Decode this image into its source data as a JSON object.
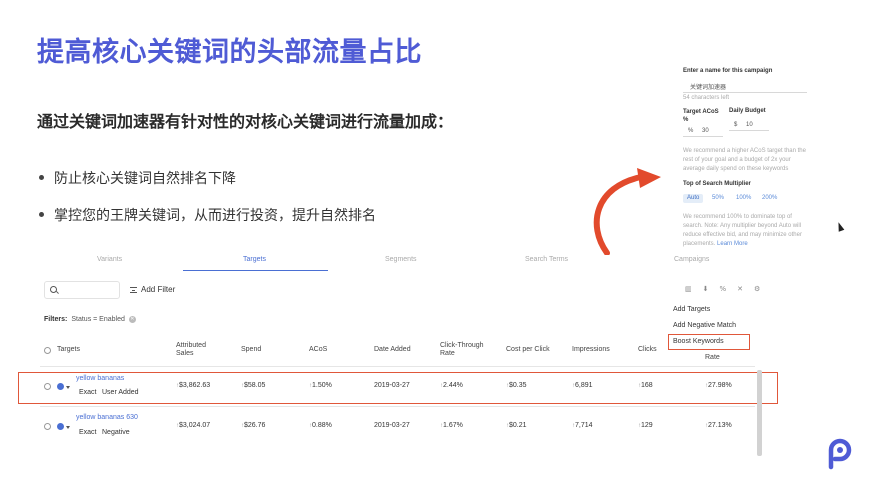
{
  "slide": {
    "title": "提高核心关键词的头部流量占比",
    "subtitle": "通过关键词加速器有针对性的对核心关键词进行流量加成：",
    "bullets": [
      "防止核心关键词自然排名下降",
      "掌控您的王牌关键词，从而进行投资，提升自然排名"
    ]
  },
  "panel": {
    "name_label": "Enter a name for this campaign",
    "name_value": "关键词加速器",
    "name_hint": "54 characters left",
    "target_acos_label": "Target ACoS %",
    "target_acos_prefix": "%",
    "target_acos_value": "30",
    "daily_budget_label": "Daily Budget",
    "daily_budget_prefix": "$",
    "daily_budget_value": "10",
    "note1": "We recommend a higher ACoS target than the rest of your goal and a budget of 2x your average daily spend on these keywords",
    "tos_label": "Top of Search Multiplier",
    "tos_options": [
      "Auto",
      "50%",
      "100%",
      "200%"
    ],
    "note2": "We recommend 100% to dominate top of search. Note: Any multiplier beyond Auto will reduce effective bid, and may minimize other placements.",
    "learn_more": "Learn More"
  },
  "tabs": [
    "Variants",
    "Targets",
    "Segments",
    "Search Terms",
    "Campaigns"
  ],
  "toolbar": {
    "search_placeholder": "",
    "add_filter": "Add Filter",
    "icons": [
      "columns-icon",
      "download-icon",
      "percent-icon",
      "close-icon",
      "settings-icon"
    ],
    "icon_glyphs": [
      "▥",
      "⬇",
      "%",
      "✕",
      "⚙"
    ]
  },
  "filters": {
    "label": "Filters:",
    "chip": "Status = Enabled"
  },
  "menu": {
    "items": [
      "Add Targets",
      "Add Negative Match",
      "Boost Keywords"
    ]
  },
  "table": {
    "headers": {
      "targets": "Targets",
      "attributed_sales": "Attributed Sales",
      "spend": "Spend",
      "acos": "ACoS",
      "date_added": "Date Added",
      "ctr": "Click-Through Rate",
      "cpc": "Cost per Click",
      "impressions": "Impressions",
      "clicks": "Clicks",
      "conv_rate_partial": "Rate"
    },
    "rows": [
      {
        "keyword": "yellow bananas",
        "match": "Exact",
        "tag": "User Added",
        "sales": "$3,862.63",
        "spend": "$58.05",
        "acos": "1.50%",
        "date": "2019-03-27",
        "ctr": "2.44%",
        "cpc": "$0.35",
        "impressions": "6,891",
        "clicks": "168",
        "conv": "27.98%"
      },
      {
        "keyword": "yellow bananas 630",
        "match": "Exact",
        "tag": "Negative",
        "sales": "$3,024.07",
        "spend": "$26.76",
        "acos": "0.88%",
        "date": "2019-03-27",
        "ctr": "1.67%",
        "cpc": "$0.21",
        "impressions": "7,714",
        "clicks": "129",
        "conv": "27.13%"
      }
    ],
    "trend_glyph": "↑"
  },
  "colors": {
    "accent": "#4f5bd5",
    "link": "#4a6fd3",
    "highlight": "#e0573a"
  }
}
